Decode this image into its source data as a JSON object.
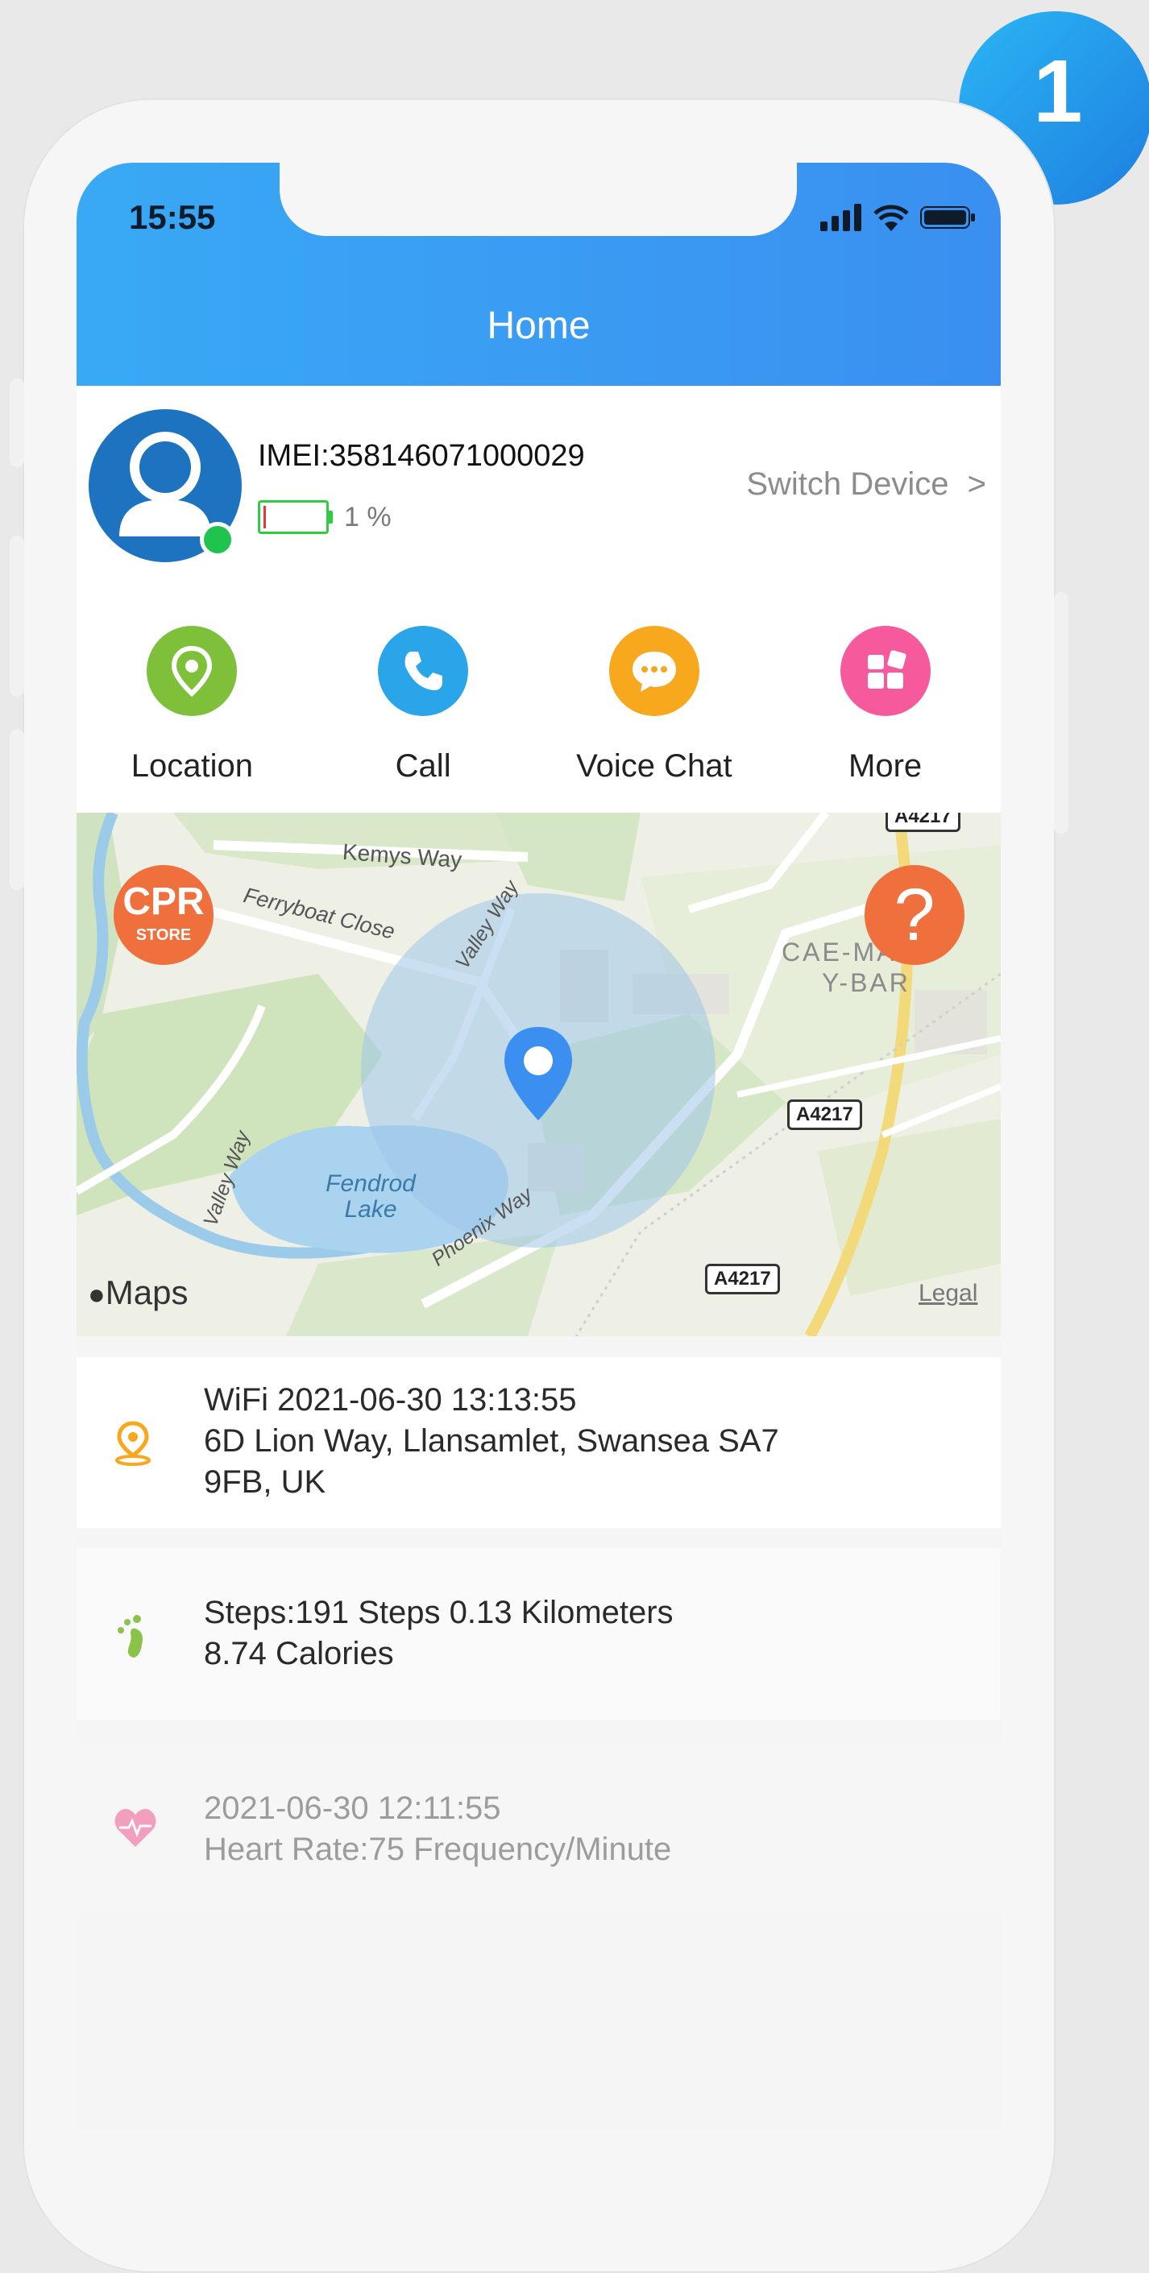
{
  "step_badge": "1",
  "status_bar": {
    "time": "15:55"
  },
  "header": {
    "title": "Home"
  },
  "device": {
    "imei": "IMEI:358146071000029",
    "battery_percent": "1 %",
    "battery_level": 0.01,
    "switch_label": "Switch Device",
    "switch_chevron": ">",
    "online_status_color": "#1fc44e"
  },
  "actions": [
    {
      "label": "Location",
      "icon": "location-pin-icon",
      "color": "#7fc03b"
    },
    {
      "label": "Call",
      "icon": "phone-icon",
      "color": "#2aa5ea"
    },
    {
      "label": "Voice Chat",
      "icon": "chat-bubble-icon",
      "color": "#f7a81d"
    },
    {
      "label": "More",
      "icon": "grid-icon",
      "color": "#f75a9c"
    }
  ],
  "map": {
    "streets": [
      "Kemys Way",
      "Ferryboat Close",
      "Valley Way",
      "Valley Way",
      "Phoenix Way"
    ],
    "water": "Fendrod Lake",
    "area_line1": "CAE-MAES-",
    "area_line2": "Y-BAR",
    "roads": [
      "A4217",
      "A4217",
      "A4217"
    ],
    "attribution": "Maps",
    "legal": "Legal",
    "store_badge_line1": "CPR",
    "store_badge_line2": "STORE",
    "help_symbol": "?"
  },
  "location_card": {
    "line1": "WiFi 2021-06-30 13:13:55",
    "line2": "6D Lion Way, Llansamlet, Swansea SA7",
    "line3": "9FB, UK"
  },
  "steps_card": {
    "line1": "Steps:191 Steps 0.13 Kilometers",
    "line2": "8.74 Calories"
  },
  "heart_card": {
    "line1": "2021-06-30 12:11:55",
    "line2": "Heart Rate:75  Frequency/Minute"
  },
  "colors": {
    "header_start": "#39a9f5",
    "header_end": "#3a8ff0",
    "help_orange": "#ef6f3d",
    "pin_blue": "#3a8ff0"
  }
}
